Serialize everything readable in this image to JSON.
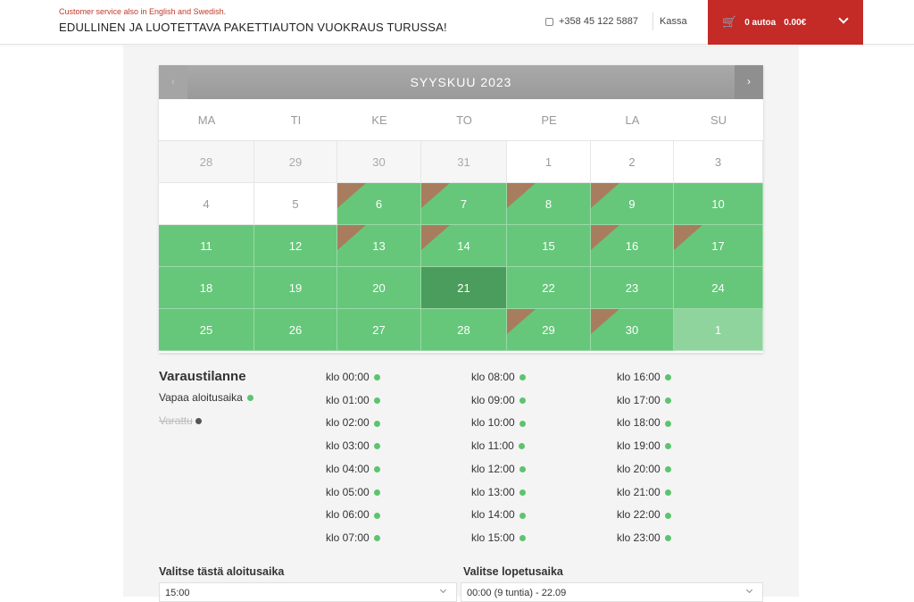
{
  "header": {
    "tagline": "Customer service also in English and Swedish.",
    "brand": "EDULLINEN JA LUOTETTAVA PAKETTIAUTON VUOKRAUS TURUSSA!",
    "phone": "+358 45 122 5887",
    "checkout_label": "Kassa",
    "cart_count": "0 autoa",
    "cart_total": "0.00€",
    "cart_color": "#c42a26"
  },
  "calendar": {
    "title": "SYYSKUU 2023",
    "prev_label": "‹",
    "next_label": "›",
    "weekdays": [
      "MA",
      "TI",
      "KE",
      "TO",
      "PE",
      "LA",
      "SU"
    ],
    "weeks": [
      [
        {
          "d": "28",
          "s": "other"
        },
        {
          "d": "29",
          "s": "other"
        },
        {
          "d": "30",
          "s": "other"
        },
        {
          "d": "31",
          "s": "other"
        },
        {
          "d": "1",
          "s": "plain"
        },
        {
          "d": "2",
          "s": "plain"
        },
        {
          "d": "3",
          "s": "plain"
        }
      ],
      [
        {
          "d": "4",
          "s": "plain"
        },
        {
          "d": "5",
          "s": "plain"
        },
        {
          "d": "6",
          "s": "avail",
          "p": true
        },
        {
          "d": "7",
          "s": "avail",
          "p": true
        },
        {
          "d": "8",
          "s": "avail",
          "p": true
        },
        {
          "d": "9",
          "s": "avail",
          "p": true
        },
        {
          "d": "10",
          "s": "avail"
        }
      ],
      [
        {
          "d": "11",
          "s": "avail"
        },
        {
          "d": "12",
          "s": "avail"
        },
        {
          "d": "13",
          "s": "avail",
          "p": true
        },
        {
          "d": "14",
          "s": "avail",
          "p": true
        },
        {
          "d": "15",
          "s": "avail"
        },
        {
          "d": "16",
          "s": "avail",
          "p": true
        },
        {
          "d": "17",
          "s": "avail",
          "p": true
        }
      ],
      [
        {
          "d": "18",
          "s": "avail"
        },
        {
          "d": "19",
          "s": "avail"
        },
        {
          "d": "20",
          "s": "avail"
        },
        {
          "d": "21",
          "s": "selected"
        },
        {
          "d": "22",
          "s": "avail"
        },
        {
          "d": "23",
          "s": "avail"
        },
        {
          "d": "24",
          "s": "avail"
        }
      ],
      [
        {
          "d": "25",
          "s": "avail"
        },
        {
          "d": "26",
          "s": "avail"
        },
        {
          "d": "27",
          "s": "avail"
        },
        {
          "d": "28",
          "s": "avail"
        },
        {
          "d": "29",
          "s": "avail",
          "p": true
        },
        {
          "d": "30",
          "s": "avail",
          "p": true
        },
        {
          "d": "1",
          "s": "light"
        }
      ]
    ],
    "colors": {
      "available": "#66c77a",
      "selected": "#4a9d5c",
      "partial": "#a87d5e"
    }
  },
  "availability": {
    "title": "Varaustilanne",
    "free_label": "Vapaa aloitusaika",
    "booked_label": "Varattu",
    "slot_columns": [
      [
        "klo 00:00",
        "klo 01:00",
        "klo 02:00",
        "klo 03:00",
        "klo 04:00",
        "klo 05:00",
        "klo 06:00",
        "klo 07:00"
      ],
      [
        "klo 08:00",
        "klo 09:00",
        "klo 10:00",
        "klo 11:00",
        "klo 12:00",
        "klo 13:00",
        "klo 14:00",
        "klo 15:00"
      ],
      [
        "klo 16:00",
        "klo 17:00",
        "klo 18:00",
        "klo 19:00",
        "klo 20:00",
        "klo 21:00",
        "klo 22:00",
        "klo 23:00"
      ]
    ]
  },
  "form": {
    "start_label": "Valitse tästä aloitusaika",
    "start_value": "15:00",
    "end_label": "Valitse lopetusaika",
    "end_value": "00:00 (9 tuntia) - 22.09"
  }
}
